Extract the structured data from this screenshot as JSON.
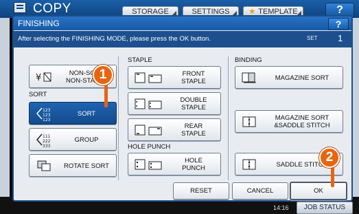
{
  "header": {
    "title": "COPY",
    "tabs": [
      {
        "label": "STORAGE"
      },
      {
        "label": "SETTINGS"
      },
      {
        "label": "TEMPLATE"
      }
    ],
    "help_label": "?"
  },
  "footer": {
    "time": "14:16",
    "job_status_label": "JOB STATUS"
  },
  "dialog": {
    "title": "FINISHING",
    "help_label": "?",
    "message": "After selecting the FINISHING MODE, please press the OK button.",
    "set_label": "SET",
    "set_value": "1",
    "left": {
      "non_sort_label": "NON-SORT\nNON-STAPLE",
      "sort_section": "SORT",
      "sort_label": "SORT",
      "group_label": "GROUP",
      "rotate_sort_label": "ROTATE SORT"
    },
    "middle": {
      "staple_section": "STAPLE",
      "front_staple_label": "FRONT\nSTAPLE",
      "double_staple_label": "DOUBLE\nSTAPLE",
      "rear_staple_label": "REAR\nSTAPLE",
      "hole_punch_section": "HOLE PUNCH",
      "hole_punch_label": "HOLE\nPUNCH"
    },
    "right": {
      "binding_section": "BINDING",
      "magazine_sort_label": "MAGAZINE SORT",
      "magazine_saddle_label": "MAGAZINE SORT\n&SADDLE STITCH",
      "saddle_stitch_label": "SADDLE STITCH"
    },
    "buttons": {
      "reset": "RESET",
      "cancel": "CANCEL",
      "ok": "OK"
    },
    "selected_option": "SORT"
  },
  "callouts": [
    {
      "number": "1"
    },
    {
      "number": "2"
    }
  ],
  "colors": {
    "accent": "#1f63b2",
    "callout": "#e8650f",
    "titlebar": "#165aa6"
  }
}
